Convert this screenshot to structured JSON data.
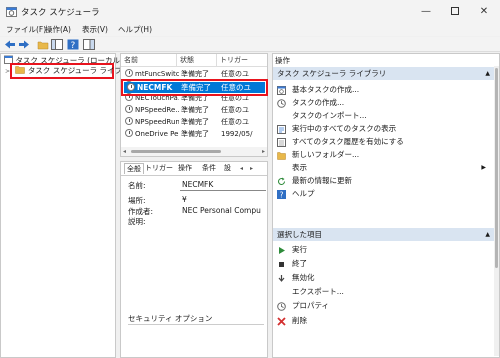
{
  "window": {
    "title": "タスク スケジューラ"
  },
  "menu": [
    "ファイル(F)",
    "操作(A)",
    "表示(V)",
    "ヘルプ(H)"
  ],
  "tree": {
    "root": "タスク スケジューラ (ローカル)",
    "library": "タスク スケジューラ ライブラリ"
  },
  "task_table": {
    "headers": [
      "名前",
      "状態",
      "トリガー"
    ],
    "rows": [
      [
        "mtFuncSwitch",
        "準備完了",
        "任意のユ"
      ],
      [
        "NECMFK",
        "準備完了",
        "任意のユ"
      ],
      [
        "NECTouchPa...",
        "準備完了",
        "任意のユ"
      ],
      [
        "NPSpeedRe...",
        "準備完了",
        "任意のユ"
      ],
      [
        "NPSpeedRun",
        "準備完了",
        "任意のユ"
      ],
      [
        "OneDrive Pe...",
        "準備完了",
        "1992/05/"
      ]
    ],
    "selected_index": 1
  },
  "detail": {
    "tabs": [
      "全般",
      "トリガー",
      "操作",
      "条件",
      "設"
    ],
    "name_label": "名前:",
    "name_value": "NECMFK",
    "location_label": "場所:",
    "location_value": "¥",
    "author_label": "作成者:",
    "author_value": "NEC Personal Compu",
    "desc_label": "説明:",
    "security_label": "セキュリティ オプション"
  },
  "actions": {
    "header": "操作",
    "section1": "タスク スケジューラ ライブラリ",
    "items1": [
      {
        "label": "基本タスクの作成...",
        "icon": "create-basic-task-icon"
      },
      {
        "label": "タスクの作成...",
        "icon": "create-task-icon"
      },
      {
        "label": "タスクのインポート...",
        "icon": ""
      },
      {
        "label": "実行中のすべてのタスクの表示",
        "icon": "running-tasks-icon"
      },
      {
        "label": "すべてのタスク履歴を有効にする",
        "icon": "history-icon"
      },
      {
        "label": "新しいフォルダー...",
        "icon": "new-folder-icon"
      },
      {
        "label": "表示",
        "icon": ""
      },
      {
        "label": "最新の情報に更新",
        "icon": "refresh-icon"
      },
      {
        "label": "ヘルプ",
        "icon": "help-icon"
      }
    ],
    "section2": "選択した項目",
    "items2": [
      {
        "label": "実行",
        "icon": "run-icon"
      },
      {
        "label": "終了",
        "icon": "stop-icon"
      },
      {
        "label": "無効化",
        "icon": "disable-icon"
      },
      {
        "label": "エクスポート...",
        "icon": ""
      },
      {
        "label": "プロパティ",
        "icon": "properties-icon"
      },
      {
        "label": "削除",
        "icon": "delete-icon"
      }
    ]
  },
  "colors": {
    "accent": "#0078d7",
    "highlight": "#e8141e",
    "section": "#d9e4f1"
  }
}
